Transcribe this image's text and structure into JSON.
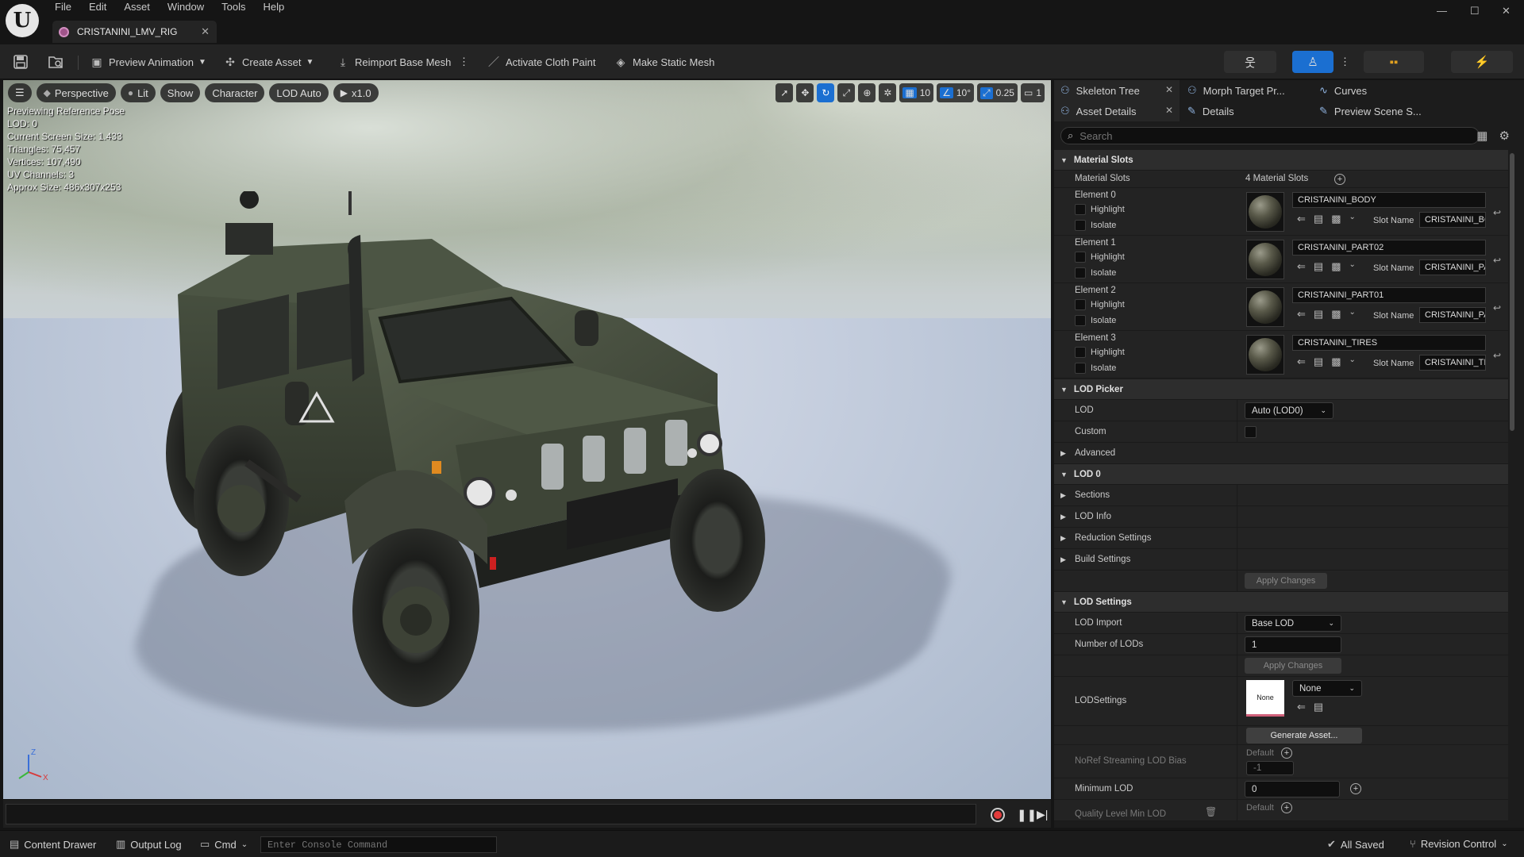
{
  "app": {
    "logo_text": "U",
    "menu": [
      "File",
      "Edit",
      "Asset",
      "Window",
      "Tools",
      "Help"
    ],
    "asset_tab": "CRISTANINI_LMV_RIG",
    "window_controls": [
      "—",
      "☐",
      "✕"
    ]
  },
  "toolbar": {
    "preview_animation": "Preview Animation",
    "create_asset": "Create Asset",
    "reimport_base_mesh": "Reimport Base Mesh",
    "activate_cloth_paint": "Activate Cloth Paint",
    "make_static_mesh": "Make Static Mesh"
  },
  "viewport": {
    "perspective": "Perspective",
    "lit": "Lit",
    "show": "Show",
    "character": "Character",
    "lod_auto": "LOD Auto",
    "speed": "x1.0",
    "grid_size": "10",
    "rotation_snap": "10°",
    "scale_snap": "0.25",
    "camera_speed": "1",
    "stats": [
      "Previewing Reference Pose",
      "LOD: 0",
      "Current Screen Size: 1.433",
      "Triangles: 75,457",
      "Vertices: 107,490",
      "UV Channels: 3",
      "Approx Size: 486x307x253"
    ],
    "axis_labels": {
      "x": "X",
      "z": "Z"
    }
  },
  "panel": {
    "tabs_row1": [
      {
        "label": "Skeleton Tree",
        "icon": "skeleton-icon",
        "closable": true
      },
      {
        "label": "Morph Target Pr...",
        "icon": "morph-icon",
        "closable": false
      },
      {
        "label": "Curves",
        "icon": "curves-icon",
        "closable": false
      }
    ],
    "tabs_row2": [
      {
        "label": "Asset Details",
        "icon": "asset-details-icon",
        "closable": true
      },
      {
        "label": "Details",
        "icon": "pencil-icon",
        "closable": false
      },
      {
        "label": "Preview Scene S...",
        "icon": "pencil-icon",
        "closable": false
      }
    ],
    "search_placeholder": "Search",
    "material_slots": {
      "category": "Material Slots",
      "label": "Material Slots",
      "count": "4 Material Slots",
      "highlight": "Highlight",
      "isolate": "Isolate",
      "slot_name_label": "Slot Name",
      "elements": [
        {
          "label": "Element 0",
          "material": "CRISTANINI_BODY",
          "slot": "CRISTANINI_BO"
        },
        {
          "label": "Element 1",
          "material": "CRISTANINI_PART02",
          "slot": "CRISTANINI_PA"
        },
        {
          "label": "Element 2",
          "material": "CRISTANINI_PART01",
          "slot": "CRISTANINI_PA"
        },
        {
          "label": "Element 3",
          "material": "CRISTANINI_TIRES",
          "slot": "CRISTANINI_TI"
        }
      ]
    },
    "lod_picker": {
      "category": "LOD Picker",
      "lod_label": "LOD",
      "lod_value": "Auto (LOD0)",
      "custom_label": "Custom",
      "advanced_label": "Advanced"
    },
    "lod0": {
      "category": "LOD 0",
      "sections": "Sections",
      "lod_info": "LOD Info",
      "reduction_settings": "Reduction Settings",
      "build_settings": "Build Settings",
      "apply_changes": "Apply Changes"
    },
    "lod_settings": {
      "category": "LOD Settings",
      "lod_import_label": "LOD Import",
      "lod_import_value": "Base LOD",
      "num_lods_label": "Number of LODs",
      "num_lods_value": "1",
      "apply_changes": "Apply Changes",
      "lodsettings_label": "LODSettings",
      "lodsettings_thumb": "None",
      "lodsettings_value": "None",
      "generate_asset": "Generate Asset...",
      "noref_label": "NoRef Streaming LOD Bias",
      "noref_default": "Default",
      "noref_value": "-1",
      "min_lod_label": "Minimum LOD",
      "min_lod_value": "0",
      "quality_label": "Quality Level Min LOD",
      "quality_default": "Default"
    }
  },
  "statusbar": {
    "content_drawer": "Content Drawer",
    "output_log": "Output Log",
    "cmd": "Cmd",
    "console_placeholder": "Enter Console Command",
    "all_saved": "All Saved",
    "revision_control": "Revision Control"
  },
  "colors": {
    "accent_blue": "#1b6fd1",
    "vehicle_body": "#4a5340",
    "record_red": "#e13b3b"
  }
}
